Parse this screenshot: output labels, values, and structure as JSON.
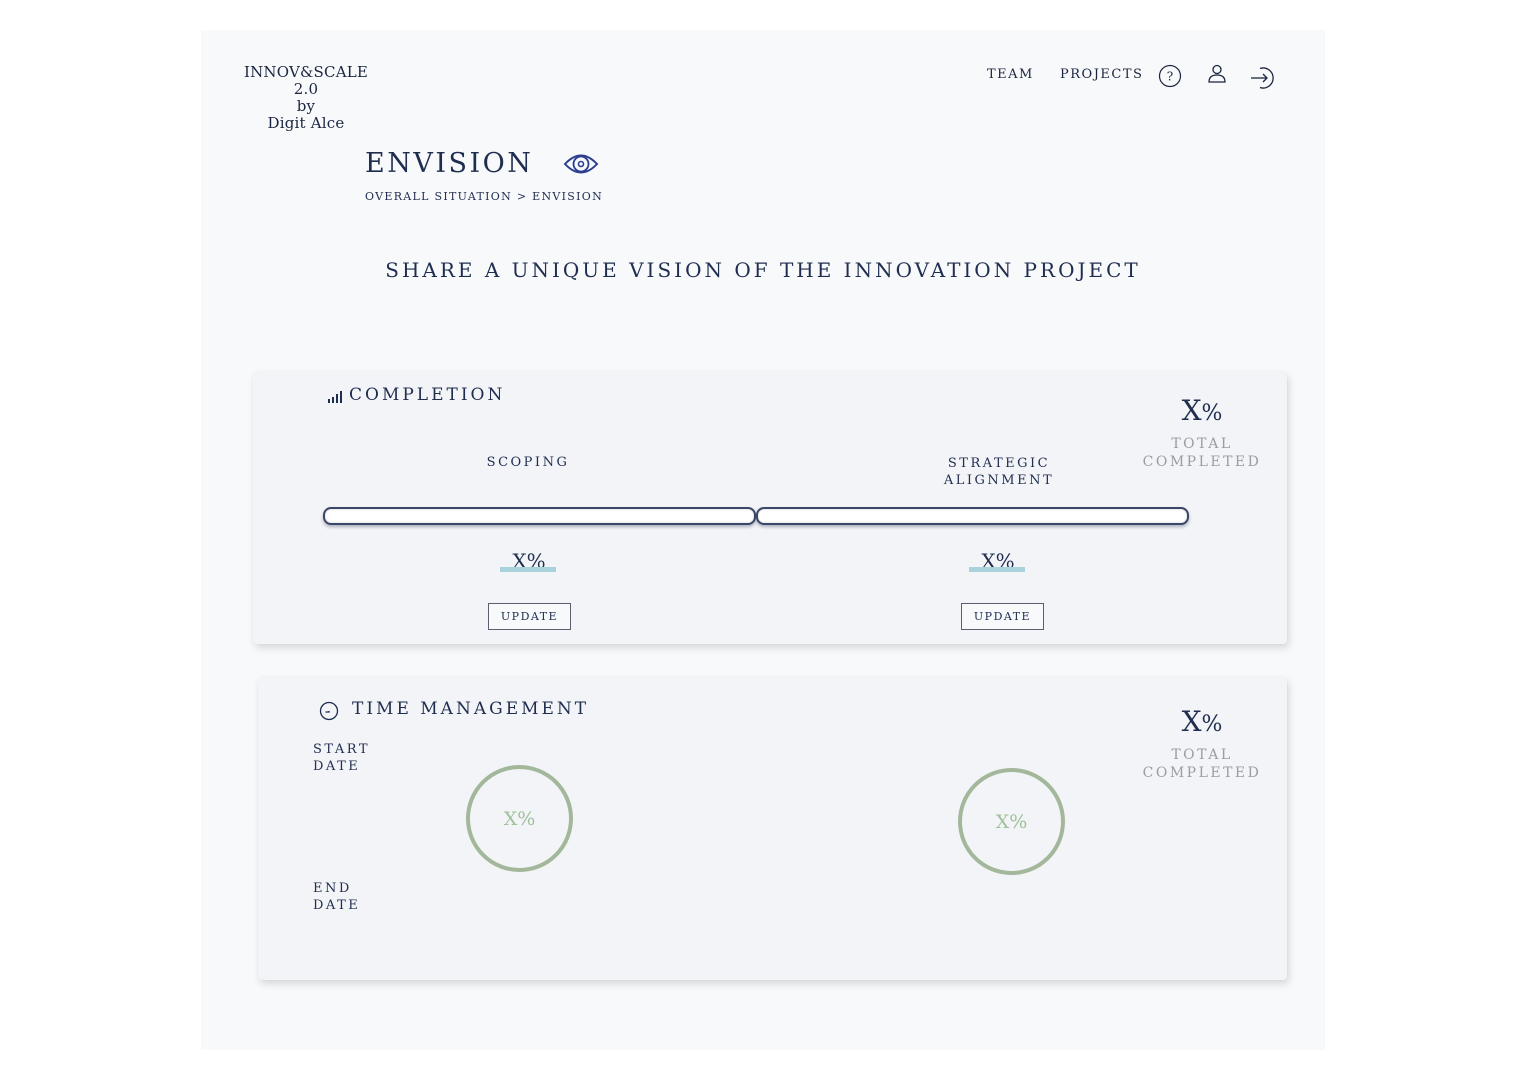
{
  "brand": {
    "line1": "INNOV&SCALE 2.0",
    "line2": "by",
    "line3": "Digit Alce"
  },
  "nav": {
    "team": "TEAM",
    "projects": "PROJECTS",
    "icons": [
      "help-icon",
      "user-icon",
      "logout-icon"
    ]
  },
  "header": {
    "title": "ENVISION",
    "title_icon": "eye-icon",
    "breadcrumb": "OVERALL SITUATION > ENVISION"
  },
  "tagline": "SHARE A UNIQUE VISION OF THE INNOVATION PROJECT",
  "completion": {
    "title": "COMPLETION",
    "icon": "signal-bars-icon",
    "total_value": "X",
    "total_sign": "%",
    "total_label_1": "TOTAL",
    "total_label_2": "COMPLETED",
    "phases": [
      {
        "label_1": "SCOPING",
        "label_2": "",
        "value": "X%",
        "button": "UPDATE"
      },
      {
        "label_1": "STRATEGIC",
        "label_2": "ALIGNMENT",
        "value": "X%",
        "button": "UPDATE"
      }
    ]
  },
  "time_management": {
    "title": "TIME MANAGEMENT",
    "icon": "clock-icon",
    "start_label_1": "START",
    "start_label_2": "DATE",
    "end_label_1": "END",
    "end_label_2": "DATE",
    "total_value": "X",
    "total_sign": "%",
    "total_label_1": "TOTAL",
    "total_label_2": "COMPLETED",
    "rings": [
      {
        "value": "X%"
      },
      {
        "value": "X%"
      }
    ]
  },
  "colors": {
    "text": "#1f2d4f",
    "muted": "#9a9da6",
    "accent_underline": "#a9d3dc",
    "ring": "#a3b79b"
  }
}
